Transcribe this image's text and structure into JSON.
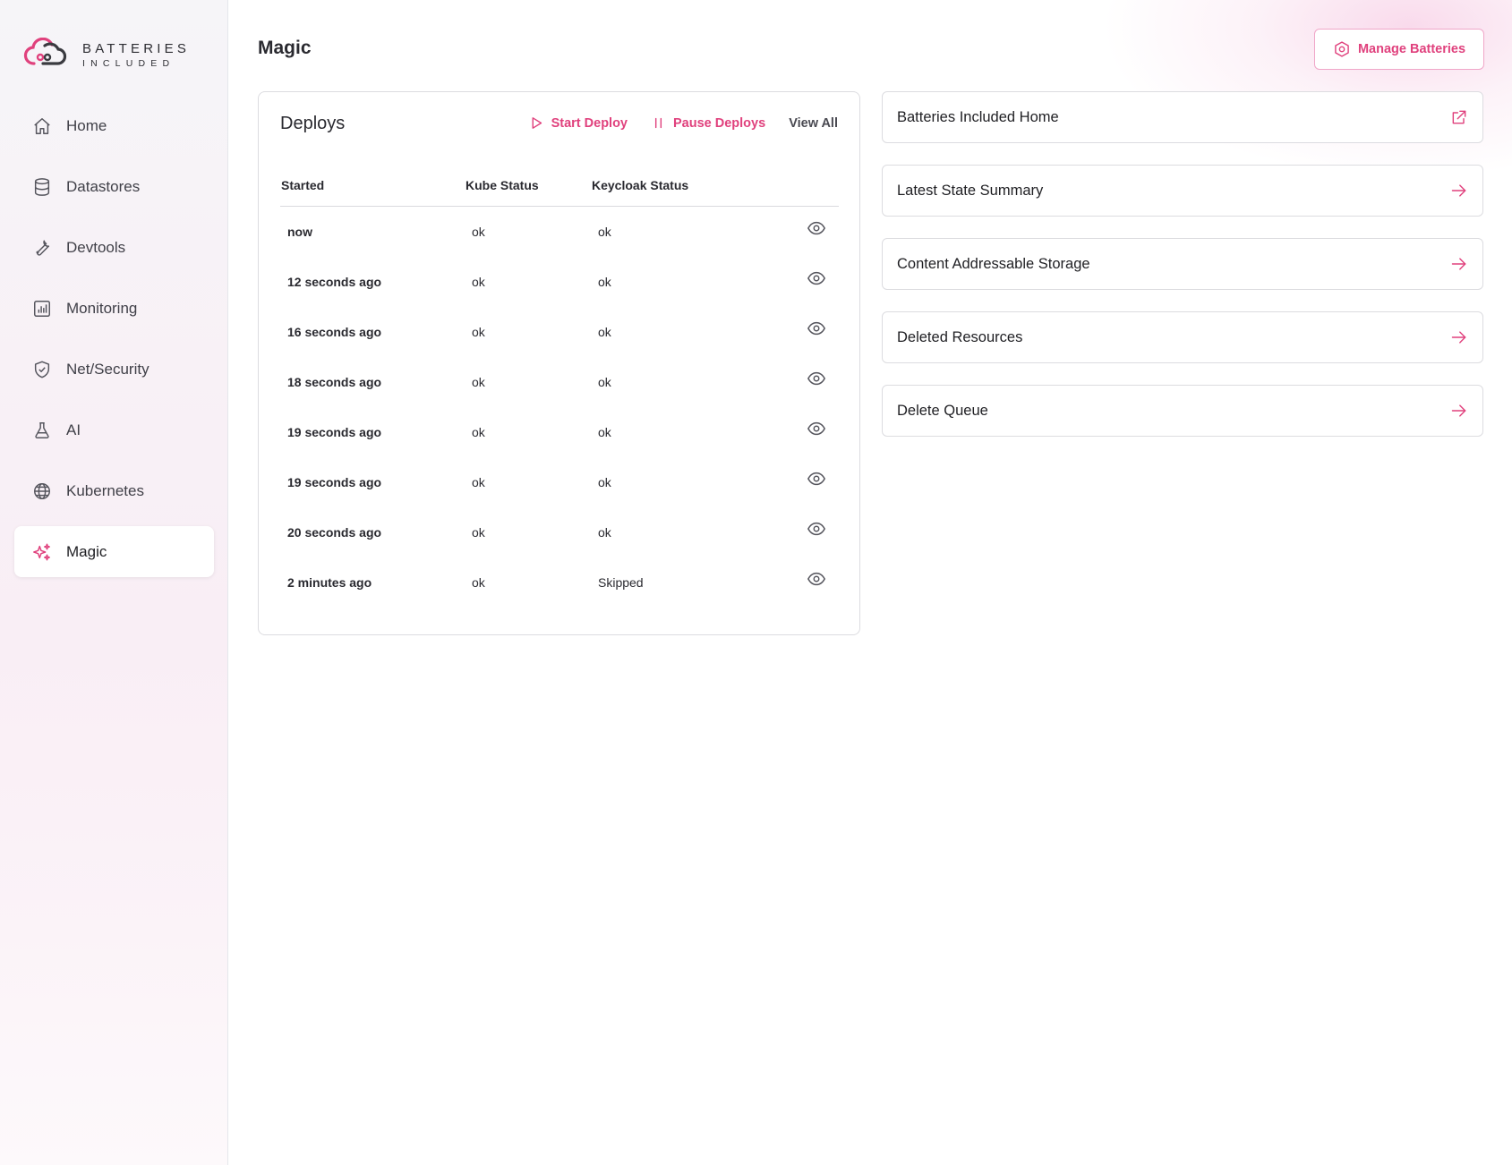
{
  "brand": {
    "line1": "BATTERIES",
    "line2": "INCLUDED",
    "accent": "#e0417d"
  },
  "sidebar": {
    "items": [
      {
        "label": "Home",
        "icon": "home-icon",
        "active": false
      },
      {
        "label": "Datastores",
        "icon": "database-icon",
        "active": false
      },
      {
        "label": "Devtools",
        "icon": "wrench-icon",
        "active": false
      },
      {
        "label": "Monitoring",
        "icon": "chart-icon",
        "active": false
      },
      {
        "label": "Net/Security",
        "icon": "shield-check-icon",
        "active": false
      },
      {
        "label": "AI",
        "icon": "flask-icon",
        "active": false
      },
      {
        "label": "Kubernetes",
        "icon": "globe-icon",
        "active": false
      },
      {
        "label": "Magic",
        "icon": "sparkles-icon",
        "active": true
      }
    ]
  },
  "header": {
    "title": "Magic",
    "manage_label": "Manage Batteries",
    "manage_icon": "hexagon-gear-icon"
  },
  "deploys": {
    "title": "Deploys",
    "start_label": "Start Deploy",
    "pause_label": "Pause Deploys",
    "view_all_label": "View All",
    "columns": [
      "Started",
      "Kube Status",
      "Keycloak Status"
    ],
    "rows": [
      {
        "started": "now",
        "kube": "ok",
        "keycloak": "ok"
      },
      {
        "started": "12 seconds ago",
        "kube": "ok",
        "keycloak": "ok"
      },
      {
        "started": "16 seconds ago",
        "kube": "ok",
        "keycloak": "ok"
      },
      {
        "started": "18 seconds ago",
        "kube": "ok",
        "keycloak": "ok"
      },
      {
        "started": "19 seconds ago",
        "kube": "ok",
        "keycloak": "ok"
      },
      {
        "started": "19 seconds ago",
        "kube": "ok",
        "keycloak": "ok"
      },
      {
        "started": "20 seconds ago",
        "kube": "ok",
        "keycloak": "ok"
      },
      {
        "started": "2 minutes ago",
        "kube": "ok",
        "keycloak": "Skipped"
      }
    ]
  },
  "links": [
    {
      "label": "Batteries Included Home",
      "icon": "external-link-icon"
    },
    {
      "label": "Latest State Summary",
      "icon": "arrow-right-icon"
    },
    {
      "label": "Content Addressable Storage",
      "icon": "arrow-right-icon"
    },
    {
      "label": "Deleted Resources",
      "icon": "arrow-right-icon"
    },
    {
      "label": "Delete Queue",
      "icon": "arrow-right-icon"
    }
  ]
}
